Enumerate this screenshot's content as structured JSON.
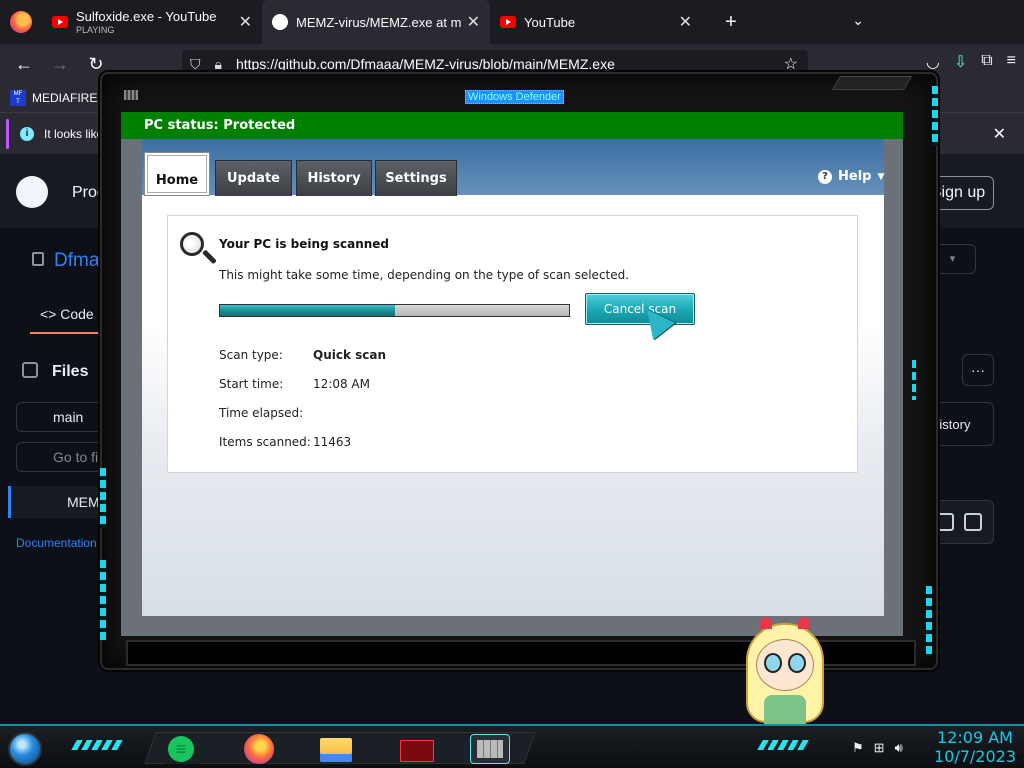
{
  "browser": {
    "tabs": [
      {
        "title": "Sulfoxide.exe - YouTube",
        "subtitle": "PLAYING",
        "icon": "youtube-icon"
      },
      {
        "title": "MEMZ-virus/MEMZ.exe at mai",
        "icon": "github-icon"
      },
      {
        "title": "YouTube",
        "icon": "youtube-icon"
      }
    ],
    "url": "https://github.com/Dfmaaa/MEMZ-virus/blob/main/MEMZ.exe",
    "bookmark": "MEDIAFIRE R",
    "notice": "It looks like"
  },
  "github": {
    "product_menu": "Prod",
    "sign_up": "Sign up",
    "repo_owner": "Dfma",
    "code_tab": "Code",
    "files_heading": "Files",
    "branch": "main",
    "goto_placeholder": "Go to file",
    "file_item": "MEMZ",
    "documentation": "Documentation",
    "history": "History",
    "more": "···"
  },
  "window": {
    "title": "Windows Defender"
  },
  "defender": {
    "status": "PC status: Protected",
    "tabs": [
      "Home",
      "Update",
      "History",
      "Settings"
    ],
    "help": "Help",
    "scan_title": "Your PC is being scanned",
    "scan_desc": "This might take some time, depending on the type of scan selected.",
    "progress_fraction": 0.5,
    "cancel_label": "Cancel scan",
    "details": [
      {
        "label": "Scan type:",
        "value": "Quick scan"
      },
      {
        "label": "Start time:",
        "value": "12:08 AM"
      },
      {
        "label": "Time elapsed:",
        "value": ""
      },
      {
        "label": "Items scanned:",
        "value": "11463"
      }
    ]
  },
  "taskbar": {
    "time": "12:09 AM",
    "date": "10/7/2023"
  },
  "colors": {
    "status_green": "#008000",
    "accent_cyan": "#1bd7ee",
    "progress": "#1d8f98"
  }
}
